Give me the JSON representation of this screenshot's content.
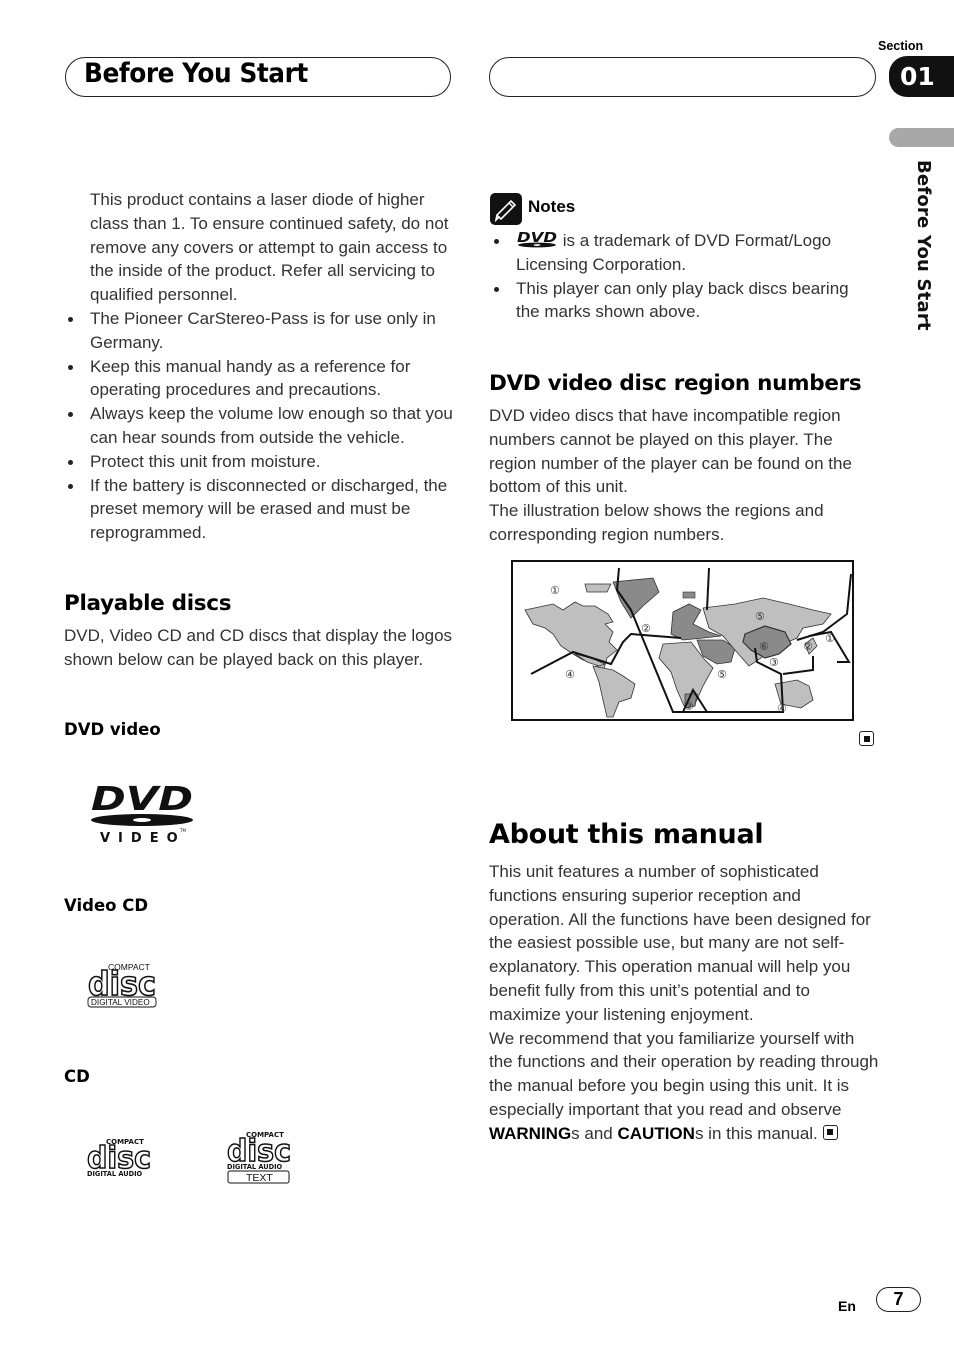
{
  "header": {
    "title": "Before You Start",
    "section_label": "Section",
    "section_number": "01",
    "side_tab_text": "Before You Start"
  },
  "left_column": {
    "intro_paragraph": "This product contains a laser diode of higher class than 1. To ensure continued safety, do not remove any covers or attempt to gain access to the inside of the product. Refer all servicing to qualified personnel.",
    "bullets": [
      "The Pioneer CarStereo-Pass is for use only in Germany.",
      "Keep this manual handy as a reference for operating procedures and precautions.",
      "Always keep the volume low enough so that you can hear sounds from outside the vehicle.",
      "Protect this unit from moisture.",
      "If the battery is disconnected or discharged, the preset memory will be erased and must be reprogrammed."
    ],
    "playable_discs": {
      "heading": "Playable discs",
      "body": "DVD, Video CD and CD discs that display the logos shown below can be played back on this player.",
      "dvd_video_label": "DVD video",
      "dvd_logo": {
        "main": "DVD",
        "sub": "VIDEO",
        "tm": "TM"
      },
      "video_cd_label": "Video CD",
      "video_cd_logo": {
        "top": "COMPACT",
        "main": "disc",
        "bottom": "DIGITAL VIDEO"
      },
      "cd_label": "CD",
      "cd_logo": {
        "top": "COMPACT",
        "main": "disc",
        "bottom": "DIGITAL AUDIO"
      },
      "cd_text_logo": {
        "top": "COMPACT",
        "main": "disc",
        "bottom": "DIGITAL AUDIO",
        "extra": "TEXT"
      }
    }
  },
  "right_column": {
    "notes": {
      "title": "Notes",
      "items": [
        {
          "logo": "DVD",
          "text": " is a trademark of DVD Format/Logo Licensing Corporation."
        },
        {
          "text": "This player can only play back discs bearing the marks shown above."
        }
      ]
    },
    "region": {
      "heading": "DVD video disc region numbers",
      "body1": "DVD video discs that have incompatible region numbers cannot be played on this player. The region number of the player can be found on the bottom of this unit.",
      "body2": "The illustration below shows the regions and corresponding region numbers.",
      "map_labels": [
        "①",
        "②",
        "②",
        "④",
        "⑤",
        "⑤",
        "⑥",
        "③",
        "②",
        "①",
        "④"
      ]
    },
    "about": {
      "heading": "About this manual",
      "body1": "This unit features a number of sophisticated functions ensuring superior reception and operation. All the functions have been designed for the easiest possible use, but many are not self-explanatory. This operation manual will help you benefit fully from this unit’s potential and to maximize your listening enjoyment.",
      "body2_start": "We recommend that you familiarize yourself with the functions and their operation by reading through the manual before you begin using this unit. It is especially important that you read and observe ",
      "warning": "WARNING",
      "s_and": "s and ",
      "caution": "CAUTION",
      "body2_end": "s in this manual."
    }
  },
  "footer": {
    "language": "En",
    "page_number": "7"
  }
}
